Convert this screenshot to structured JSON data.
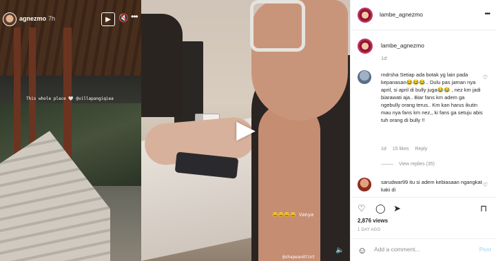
{
  "story": {
    "username": "agnezmo",
    "time": "7h",
    "caption": "This whole place 🤍 @villapangiqiea",
    "icons": [
      "play-icon",
      "mute-icon",
      "more-icon"
    ]
  },
  "video": {
    "emoji_caption": "😄😄😄😄 Vanya",
    "tag": "@shapeandtint"
  },
  "post": {
    "header_username": "lambe_agnezmo",
    "caption_username": "lambe_agnezmo",
    "caption_time": "1d",
    "comments": [
      {
        "username": "rndrsha",
        "text": "Setiap ada botak yg lain pada kepanasan😂😂😂.. Dulu pas jaman nya april, si april di bully juga😂😂 , nez km jadi biarawati aja.. Biar fans km adem ga ngebully orang terus.. Km kan harus ikutin mau nya fans km nez,, ki fans ga setuju abis tuh orang di bully !!",
        "time": "1d",
        "likes": "15 likes",
        "reply": "Reply",
        "view_replies": "View replies (35)"
      },
      {
        "username": "sarudwar99",
        "text": "itu si adem kebiasaan ngangkat kaki di"
      }
    ],
    "views": "2,876 views",
    "posted": "1 DAY AGO",
    "add_comment_placeholder": "Add a comment...",
    "post_label": "Post"
  }
}
